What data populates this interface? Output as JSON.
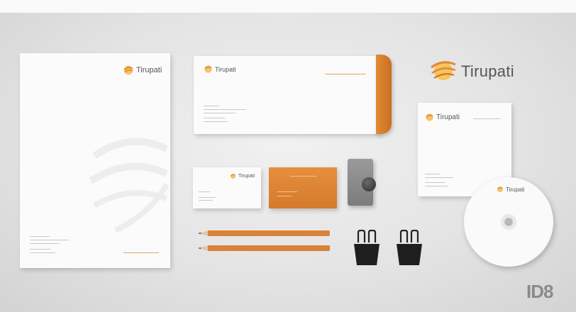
{
  "brand": {
    "name": "Tirupati",
    "accent_color": "#e08a36",
    "icon": "tirupati-swirl-logo-icon"
  },
  "corner_logo": "ID8"
}
